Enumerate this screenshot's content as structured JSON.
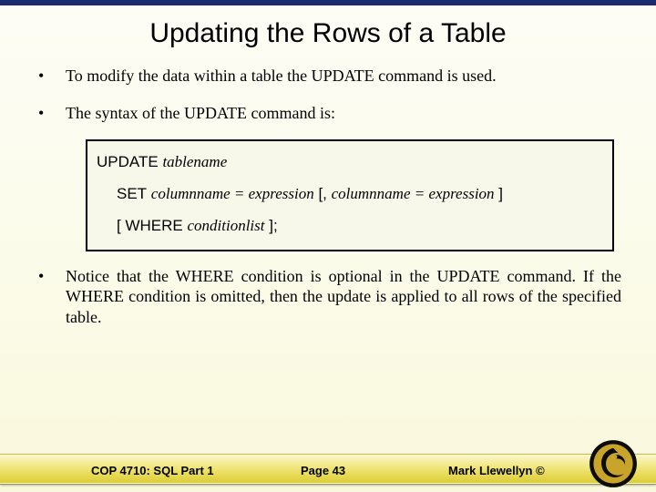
{
  "title": "Updating the Rows of a Table",
  "bullets": {
    "b1": "To modify the data within a table the UPDATE command is used.",
    "b2": "The syntax of the UPDATE command is:",
    "b3": "Notice that the WHERE condition is optional in the UPDATE command.  If the WHERE condition is omitted, then the update is applied to all rows of the specified table."
  },
  "syntax": {
    "kw_update": "UPDATE",
    "tablename": "tablename",
    "kw_set": "SET",
    "col_eq_expr_1": "columnname = expression",
    "open_bracket_comma": "[,",
    "col_eq_expr_2": "columnname = expression",
    "close_bracket": "]",
    "open_bracket": "[",
    "kw_where": "WHERE",
    "conditionlist": "conditionlist",
    "close_bracket_semi": "];"
  },
  "footer": {
    "left": "COP 4710: SQL Part 1",
    "mid": "Page 43",
    "right": "Mark Llewellyn ©"
  }
}
